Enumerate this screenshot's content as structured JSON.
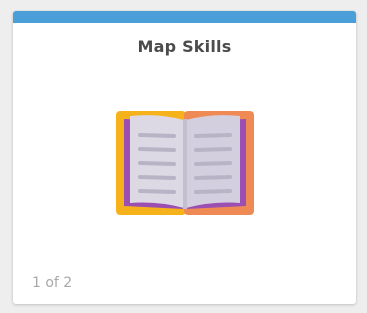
{
  "card": {
    "title": "Map Skills",
    "page_counter": "1 of 2",
    "icon": "open-book-icon"
  },
  "colors": {
    "accent_bar": "#4a9fd8",
    "title_text": "#4b4b4b",
    "counter_text": "#a8a8a8",
    "book_cover_left": "#f5b21b",
    "book_cover_right": "#f08a55",
    "book_spine": "#9b4fb0",
    "book_page": "#dcd8e4",
    "book_page_lines": "#b9b3c6"
  }
}
